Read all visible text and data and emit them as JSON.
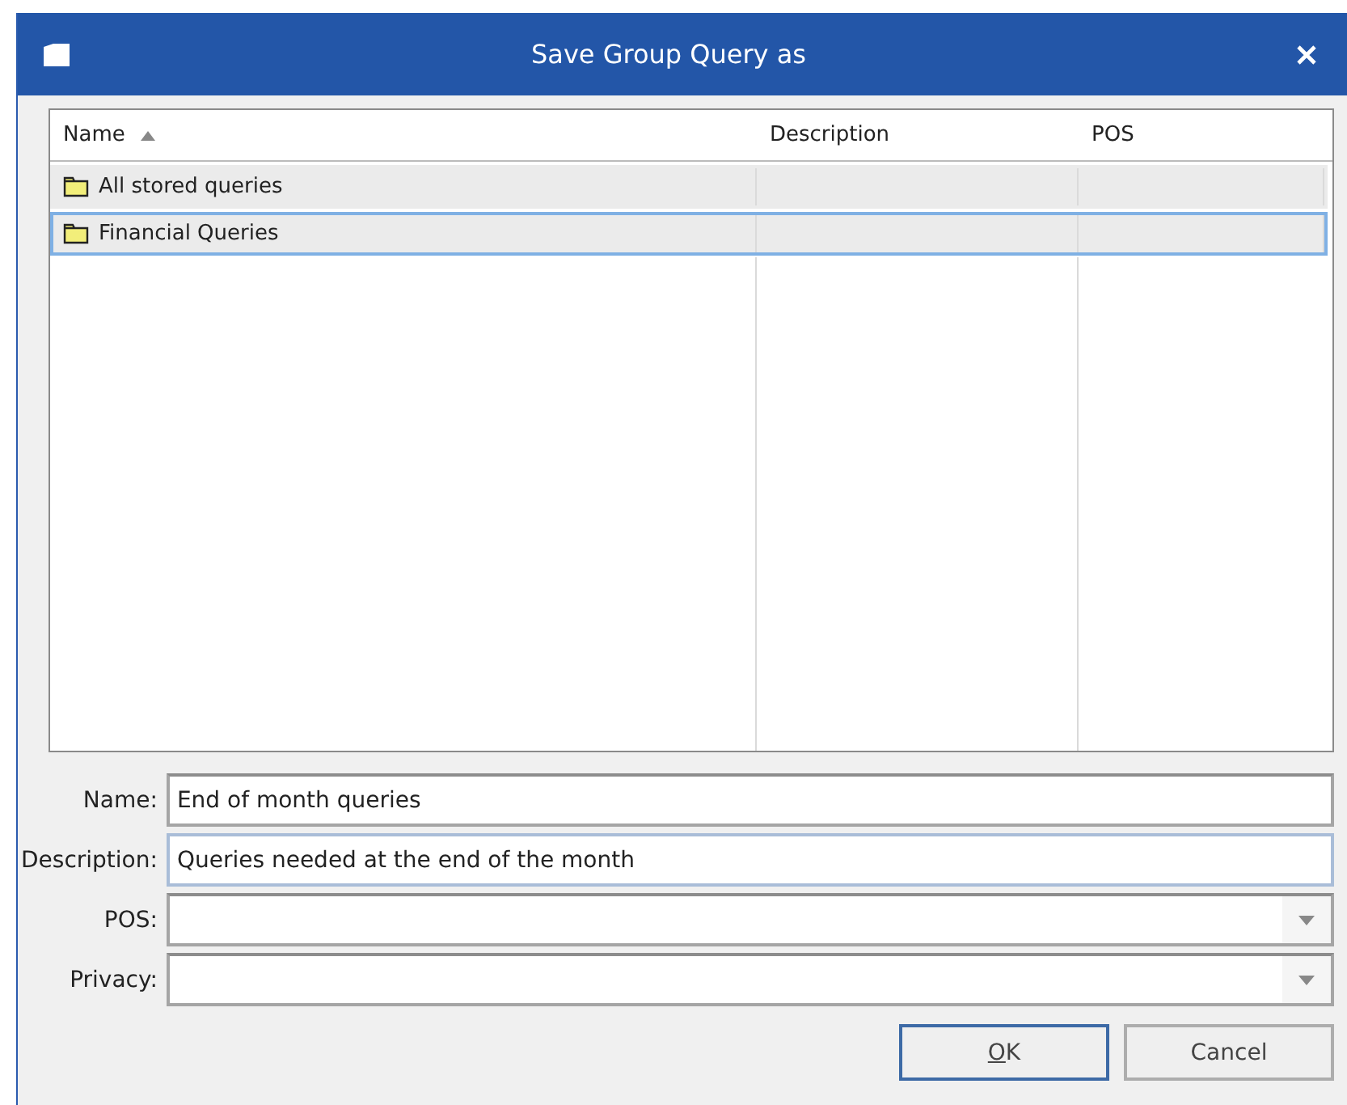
{
  "window": {
    "title": "Save Group Query as"
  },
  "table": {
    "columns": [
      {
        "label": "Name",
        "sorted_ascending": true
      },
      {
        "label": "Description",
        "sorted_ascending": false
      },
      {
        "label": "POS",
        "sorted_ascending": false
      }
    ],
    "rows": [
      {
        "cells": [
          "All stored queries"
        ],
        "selected": false
      },
      {
        "cells": [
          "Financial Queries"
        ],
        "selected": true
      }
    ]
  },
  "form": [
    {
      "kind": "text",
      "label": "Name:",
      "value": "End of month queries",
      "focused": false
    },
    {
      "kind": "text",
      "label": "Description:",
      "value": "Queries needed at the end of the month",
      "focused": true
    },
    {
      "kind": "dropdown",
      "label": "POS:",
      "focused": false
    },
    {
      "kind": "dropdown",
      "label": "Privacy:",
      "focused": false
    }
  ],
  "buttons": [
    {
      "label": "OK",
      "default": true,
      "mnemonic_first": true
    },
    {
      "label": "Cancel",
      "default": false,
      "mnemonic_first": false
    }
  ]
}
